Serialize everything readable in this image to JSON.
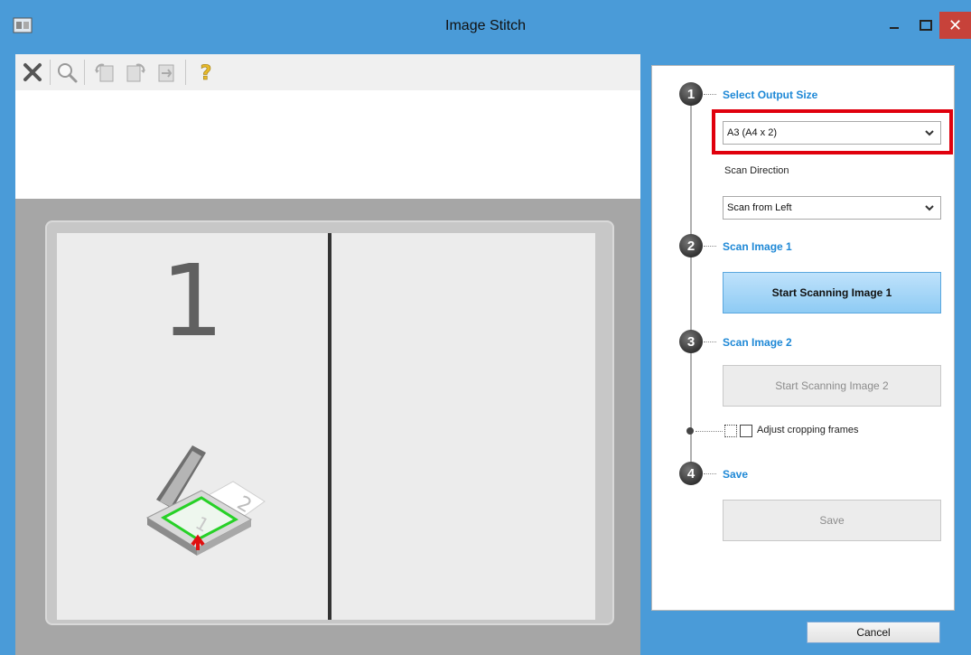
{
  "window": {
    "title": "Image Stitch"
  },
  "toolbar": {
    "tools": [
      "close-image-icon",
      "zoom-icon",
      "rotate-left-icon",
      "rotate-right-icon",
      "flip-icon",
      "help-icon"
    ]
  },
  "preview": {
    "panel_number": "1"
  },
  "steps": [
    {
      "number": "1",
      "label": "Select Output Size"
    },
    {
      "number": "2",
      "label": "Scan Image 1"
    },
    {
      "number": "3",
      "label": "Scan Image 2"
    },
    {
      "number": "4",
      "label": "Save"
    }
  ],
  "output_size": {
    "selected": "A3 (A4 x 2)"
  },
  "scan_direction": {
    "label": "Scan Direction",
    "selected": "Scan from Left"
  },
  "buttons": {
    "scan_image_1": "Start Scanning Image 1",
    "scan_image_2": "Start Scanning Image 2",
    "save": "Save",
    "cancel": "Cancel"
  },
  "cropping": {
    "label": "Adjust cropping frames"
  },
  "colors": {
    "accent_blue": "#1e88d6",
    "highlight_red": "#e0000d",
    "close_red": "#c7423a"
  }
}
